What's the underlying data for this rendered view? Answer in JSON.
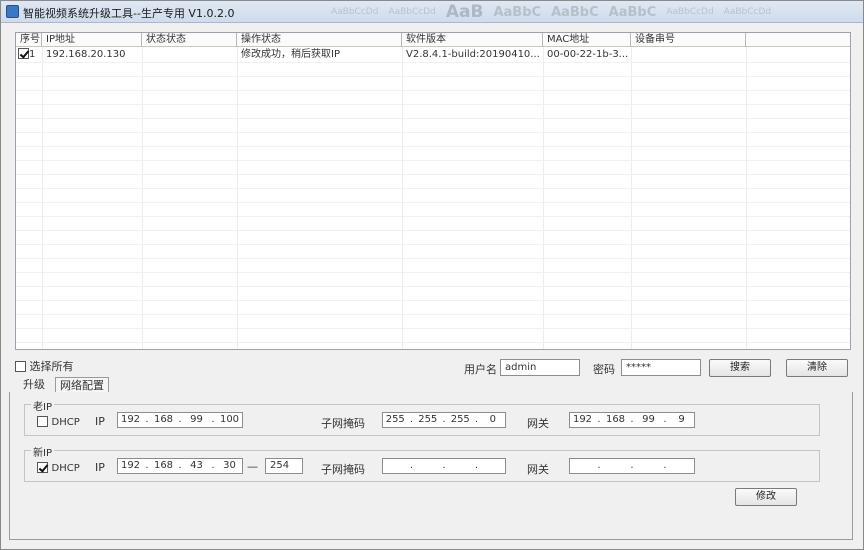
{
  "window": {
    "title": "智能视频系统升级工具--生产专用 V1.0.2.0"
  },
  "ribbon_ghost": [
    "AaBbCcDd",
    "AaBbCcDd",
    "AaB",
    "AaBbC",
    "AaBbC",
    "AaBbC",
    "AaBbCcDd",
    "AaBbCcDd"
  ],
  "table": {
    "columns": [
      "序号",
      "IP地址",
      "状态状态",
      "操作状态",
      "软件版本",
      "MAC地址",
      "设备串号"
    ],
    "rows": [
      {
        "checked": true,
        "index": "1",
        "ip": "192.168.20.130",
        "status": "",
        "op_status": "修改成功，稍后获取IP",
        "version": "V2.8.4.1-build:20190410...",
        "mac": "00-00-22-1b-3...",
        "serial": ""
      }
    ]
  },
  "controls": {
    "select_all_label": "选择所有",
    "username_label": "用户名",
    "username_value": "admin",
    "password_label": "密码",
    "password_value": "*****",
    "search_button": "搜索",
    "clear_button": "清除"
  },
  "tabs": [
    {
      "label": "升级",
      "active": false
    },
    {
      "label": "网络配置",
      "active": true
    }
  ],
  "old_ip": {
    "group_title": "老IP",
    "dhcp_label": "DHCP",
    "dhcp_checked": false,
    "ip_label": "IP",
    "ip": [
      "192",
      "168",
      "99",
      "100"
    ],
    "mask_label": "子网掩码",
    "mask": [
      "255",
      "255",
      "255",
      "0"
    ],
    "gateway_label": "网关",
    "gateway": [
      "192",
      "168",
      "99",
      "9"
    ]
  },
  "new_ip": {
    "group_title": "新IP",
    "dhcp_label": "DHCP",
    "dhcp_checked": true,
    "ip_label": "IP",
    "ip": [
      "192",
      "168",
      "43",
      "30"
    ],
    "range_sep": "—",
    "ip_end": "254",
    "mask_label": "子网掩码",
    "mask": [
      "",
      "",
      "",
      ""
    ],
    "gateway_label": "网关",
    "gateway": [
      "",
      "",
      "",
      ""
    ]
  },
  "modify_button": "修改"
}
